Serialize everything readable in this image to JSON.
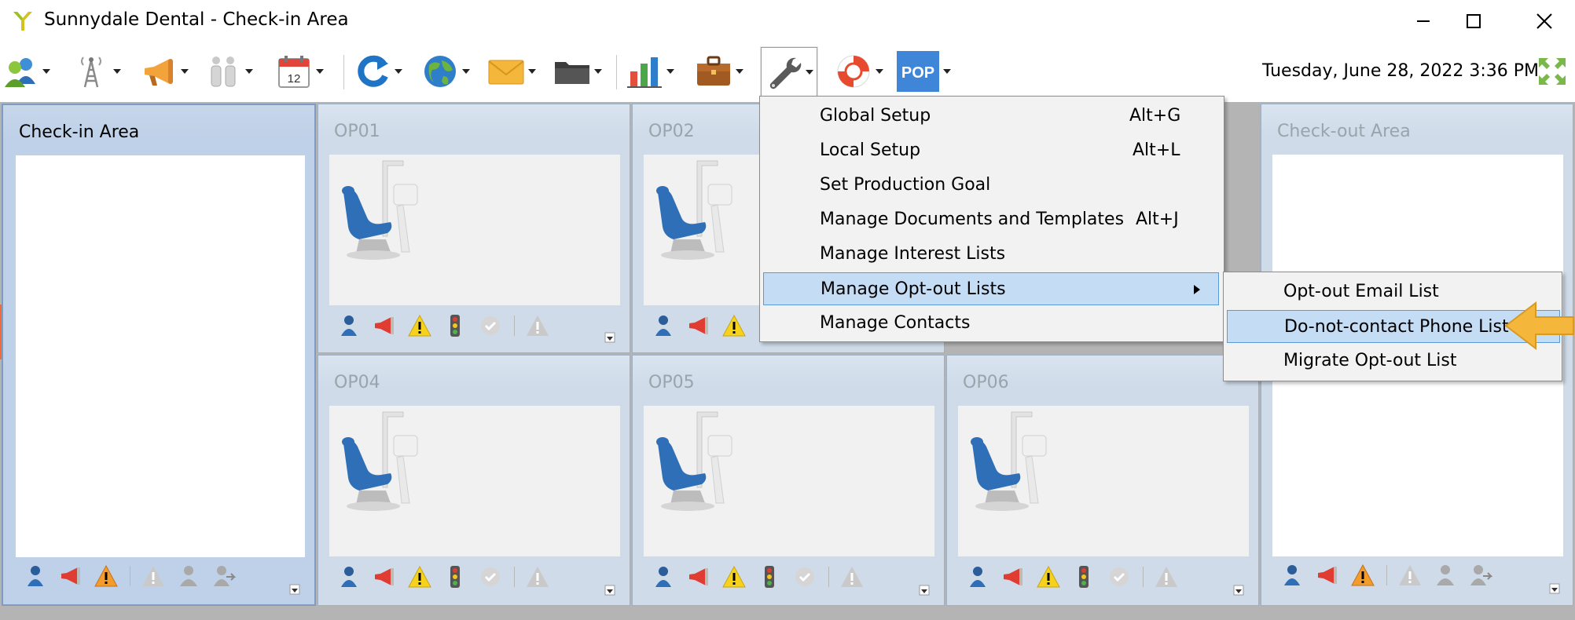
{
  "window": {
    "title": "Sunnydale Dental - Check-in Area",
    "controls": [
      "minimize",
      "maximize",
      "close"
    ]
  },
  "toolbar": {
    "buttons": [
      {
        "icon": "patients-icon"
      },
      {
        "icon": "antenna-tower-icon"
      },
      {
        "icon": "megaphone-icon"
      },
      {
        "icon": "people-icon"
      },
      {
        "icon": "calendar-icon",
        "text": "12"
      },
      {
        "icon": "refresh-icon"
      },
      {
        "icon": "globe-icon"
      },
      {
        "icon": "envelope-icon"
      },
      {
        "icon": "folder-icon"
      },
      {
        "icon": "bar-chart-icon"
      },
      {
        "icon": "briefcase-icon"
      },
      {
        "icon": "wrench-icon",
        "active": true
      },
      {
        "icon": "lifebuoy-icon"
      },
      {
        "icon": "pop-icon",
        "text": "POP"
      }
    ],
    "datetime": "Tuesday, June 28, 2022 3:36 PM"
  },
  "panels": [
    {
      "title": "Check-in Area",
      "kind": "area",
      "selected": true
    },
    {
      "title": "OP01",
      "kind": "operatory"
    },
    {
      "title": "OP02",
      "kind": "operatory"
    },
    {
      "title": "Check-out Area",
      "kind": "area"
    },
    {
      "title": "OP04",
      "kind": "operatory"
    },
    {
      "title": "OP05",
      "kind": "operatory"
    },
    {
      "title": "OP06",
      "kind": "operatory"
    }
  ],
  "menu": {
    "items": [
      {
        "label": "Global Setup",
        "shortcut": "Alt+G"
      },
      {
        "label": "Local Setup",
        "shortcut": "Alt+L"
      },
      {
        "label": "Set Production Goal",
        "shortcut": ""
      },
      {
        "label": "Manage Documents and Templates",
        "shortcut": "Alt+J"
      },
      {
        "label": "Manage Interest Lists",
        "shortcut": ""
      },
      {
        "label": "Manage Opt-out Lists",
        "shortcut": "",
        "submenu": true,
        "highlighted": true
      },
      {
        "label": "Manage Contacts",
        "shortcut": ""
      }
    ]
  },
  "submenu": {
    "items": [
      {
        "label": "Opt-out Email List"
      },
      {
        "label": "Do-not-contact Phone List",
        "highlighted": true
      },
      {
        "label": "Migrate Opt-out List"
      }
    ]
  },
  "colors": {
    "panel_bg": "#cfdbe9",
    "menu_highlight": "#c5dcf5",
    "callout": "#f5b73b"
  }
}
